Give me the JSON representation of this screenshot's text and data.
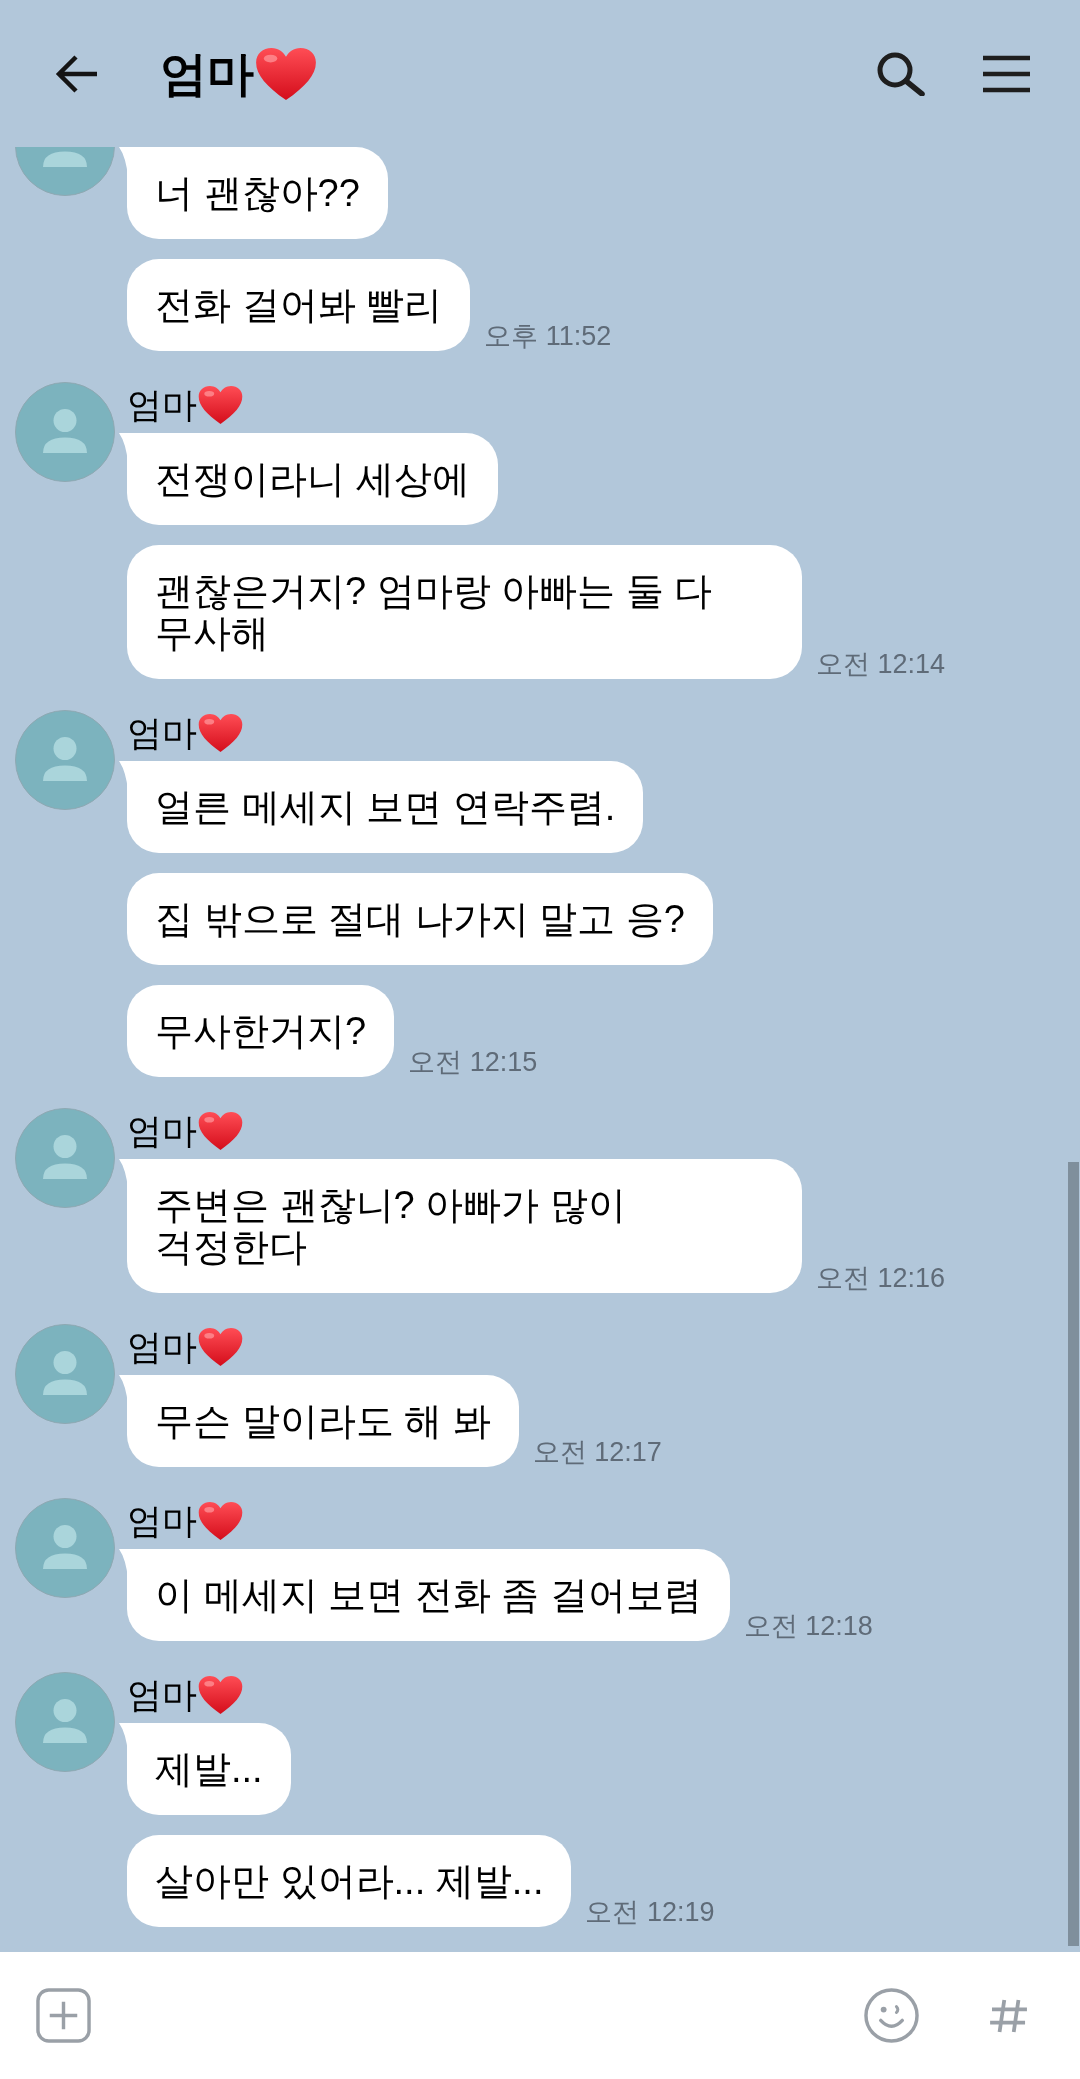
{
  "header": {
    "title": "엄마"
  },
  "groups": [
    {
      "messages": [
        "너 괜찮아??",
        "전화 걸어봐 빨리"
      ],
      "time": "오후 11:52"
    },
    {
      "sender": "엄마",
      "messages": [
        "전쟁이라니 세상에",
        "괜찮은거지? 엄마랑 아빠는 둘 다 무사해"
      ],
      "time": "오전 12:14"
    },
    {
      "sender": "엄마",
      "messages": [
        "얼른 메세지 보면 연락주렴.",
        "집 밖으로 절대 나가지 말고 응?",
        "무사한거지?"
      ],
      "time": "오전 12:15"
    },
    {
      "sender": "엄마",
      "messages": [
        "주변은 괜찮니? 아빠가 많이 걱정한다"
      ],
      "time": "오전 12:16"
    },
    {
      "sender": "엄마",
      "messages": [
        "무슨 말이라도 해 봐"
      ],
      "time": "오전 12:17"
    },
    {
      "sender": "엄마",
      "messages": [
        "이 메세지 보면 전화 좀 걸어보렴"
      ],
      "time": "오전 12:18"
    },
    {
      "sender": "엄마",
      "messages": [
        "제발...",
        "살아만 있어라... 제발..."
      ],
      "time": "오전 12:19"
    }
  ]
}
